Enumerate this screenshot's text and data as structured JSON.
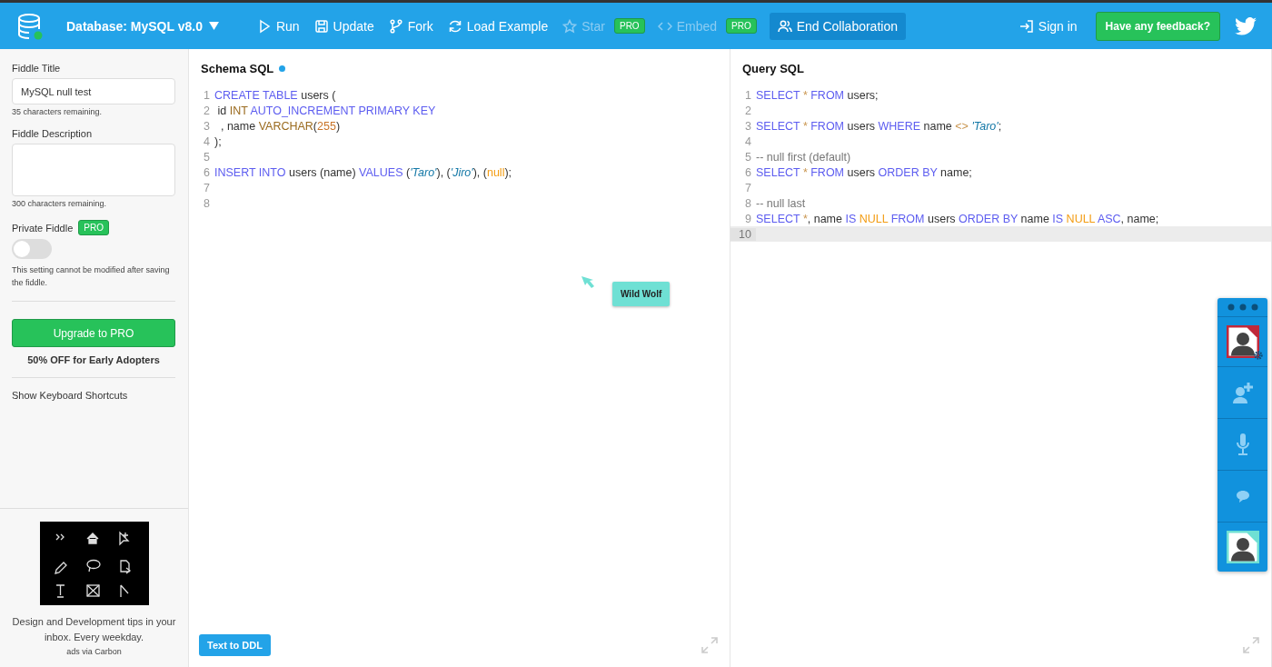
{
  "navbar": {
    "database": "Database: MySQL v8.0",
    "actions": [
      {
        "label": "Run",
        "disabled": false,
        "active": false
      },
      {
        "label": "Update",
        "disabled": false,
        "active": false
      },
      {
        "label": "Fork",
        "disabled": false,
        "active": false
      },
      {
        "label": "Load Example",
        "disabled": false,
        "active": false
      },
      {
        "label": "Star",
        "disabled": true,
        "active": false,
        "badge": "PRO"
      },
      {
        "label": "Embed",
        "disabled": true,
        "active": false,
        "badge": "PRO"
      },
      {
        "label": "End Collaboration",
        "disabled": false,
        "active": true
      }
    ],
    "sign_in": "Sign in",
    "feedback": "Have any feedback?"
  },
  "sidebar": {
    "title_label": "Fiddle Title",
    "title_value": "MySQL null test",
    "title_hint": "35 characters remaining.",
    "description_label": "Fiddle Description",
    "description_hint": "300 characters remaining.",
    "private_label": "Private Fiddle",
    "private_badge": "PRO",
    "private_on": false,
    "private_note": "This setting cannot be modified after saving the fiddle.",
    "upgrade_button": "Upgrade to PRO",
    "upgrade_note": "50% OFF for Early Adopters",
    "shortcuts_link": "Show Keyboard Shortcuts",
    "ad": {
      "text": "Design and Development tips in your inbox. Every weekday.",
      "credit": "ads via Carbon"
    }
  },
  "panels": [
    {
      "title": "Schema SQL",
      "modified": true,
      "button": "Text to DDL",
      "lines": [
        {
          "number": "1",
          "selected": false,
          "tokens": [
            {
              "kind": "keyword",
              "text": "CREATE TABLE"
            },
            {
              "kind": "plain",
              "text": " users ("
            }
          ]
        },
        {
          "number": "2",
          "selected": false,
          "tokens": [
            {
              "kind": "plain",
              "text": " id "
            },
            {
              "kind": "type",
              "text": "INT"
            },
            {
              "kind": "keyword",
              "text": " AUTO_INCREMENT PRIMARY KEY"
            }
          ]
        },
        {
          "number": "3",
          "selected": false,
          "tokens": [
            {
              "kind": "plain",
              "text": "  , name "
            },
            {
              "kind": "type",
              "text": "VARCHAR"
            },
            {
              "kind": "plain",
              "text": "("
            },
            {
              "kind": "number",
              "text": "255"
            },
            {
              "kind": "plain",
              "text": ")"
            }
          ]
        },
        {
          "number": "4",
          "selected": false,
          "tokens": [
            {
              "kind": "plain",
              "text": ");"
            }
          ]
        },
        {
          "number": "5",
          "selected": false
        },
        {
          "number": "6",
          "selected": false,
          "tokens": [
            {
              "kind": "keyword",
              "text": "INSERT INTO"
            },
            {
              "kind": "plain",
              "text": " users (name) "
            },
            {
              "kind": "keyword",
              "text": "VALUES"
            },
            {
              "kind": "plain",
              "text": " ("
            },
            {
              "kind": "string",
              "text": "'Taro'"
            },
            {
              "kind": "plain",
              "text": "), ("
            },
            {
              "kind": "string",
              "text": "'Jiro'"
            },
            {
              "kind": "plain",
              "text": "), ("
            },
            {
              "kind": "null",
              "text": "null"
            },
            {
              "kind": "plain",
              "text": ");"
            }
          ]
        },
        {
          "number": "7",
          "selected": false
        },
        {
          "number": "8",
          "selected": false
        }
      ]
    },
    {
      "title": "Query SQL",
      "modified": false,
      "lines": [
        {
          "number": "1",
          "selected": false,
          "tokens": [
            {
              "kind": "keyword",
              "text": "SELECT"
            },
            {
              "kind": "operator",
              "text": " * "
            },
            {
              "kind": "keyword",
              "text": "FROM"
            },
            {
              "kind": "plain",
              "text": " users;"
            }
          ]
        },
        {
          "number": "2",
          "selected": false
        },
        {
          "number": "3",
          "selected": false,
          "tokens": [
            {
              "kind": "keyword",
              "text": "SELECT"
            },
            {
              "kind": "operator",
              "text": " * "
            },
            {
              "kind": "keyword",
              "text": "FROM"
            },
            {
              "kind": "plain",
              "text": " users "
            },
            {
              "kind": "keyword",
              "text": "WHERE"
            },
            {
              "kind": "plain",
              "text": " name "
            },
            {
              "kind": "operator",
              "text": "<>"
            },
            {
              "kind": "string",
              "text": " 'Taro'"
            },
            {
              "kind": "plain",
              "text": ";"
            }
          ]
        },
        {
          "number": "4",
          "selected": false
        },
        {
          "number": "5",
          "selected": false,
          "tokens": [
            {
              "kind": "comment",
              "text": "-- null first (default)"
            }
          ]
        },
        {
          "number": "6",
          "selected": false,
          "tokens": [
            {
              "kind": "keyword",
              "text": "SELECT"
            },
            {
              "kind": "operator",
              "text": " * "
            },
            {
              "kind": "keyword",
              "text": "FROM"
            },
            {
              "kind": "plain",
              "text": " users "
            },
            {
              "kind": "keyword",
              "text": "ORDER BY"
            },
            {
              "kind": "plain",
              "text": " name;"
            }
          ]
        },
        {
          "number": "7",
          "selected": false
        },
        {
          "number": "8",
          "selected": false,
          "tokens": [
            {
              "kind": "comment",
              "text": "-- null last"
            }
          ]
        },
        {
          "number": "9",
          "selected": false,
          "tokens": [
            {
              "kind": "keyword",
              "text": "SELECT"
            },
            {
              "kind": "operator",
              "text": " *"
            },
            {
              "kind": "plain",
              "text": ", name "
            },
            {
              "kind": "keyword",
              "text": "IS"
            },
            {
              "kind": "null",
              "text": " NULL"
            },
            {
              "kind": "keyword",
              "text": " FROM"
            },
            {
              "kind": "plain",
              "text": " users "
            },
            {
              "kind": "keyword",
              "text": "ORDER BY"
            },
            {
              "kind": "plain",
              "text": " name "
            },
            {
              "kind": "keyword",
              "text": "IS"
            },
            {
              "kind": "null",
              "text": " NULL"
            },
            {
              "kind": "keyword",
              "text": " ASC"
            },
            {
              "kind": "plain",
              "text": ", name;"
            }
          ]
        },
        {
          "number": "10",
          "selected": true
        }
      ]
    }
  ],
  "cursor": {
    "name": "Wild Wolf",
    "color": "#6fe0d4"
  },
  "participants": [
    {
      "color": "#c0283a",
      "settings": true
    },
    {
      "color": "#6fe0d4",
      "settings": false
    }
  ]
}
